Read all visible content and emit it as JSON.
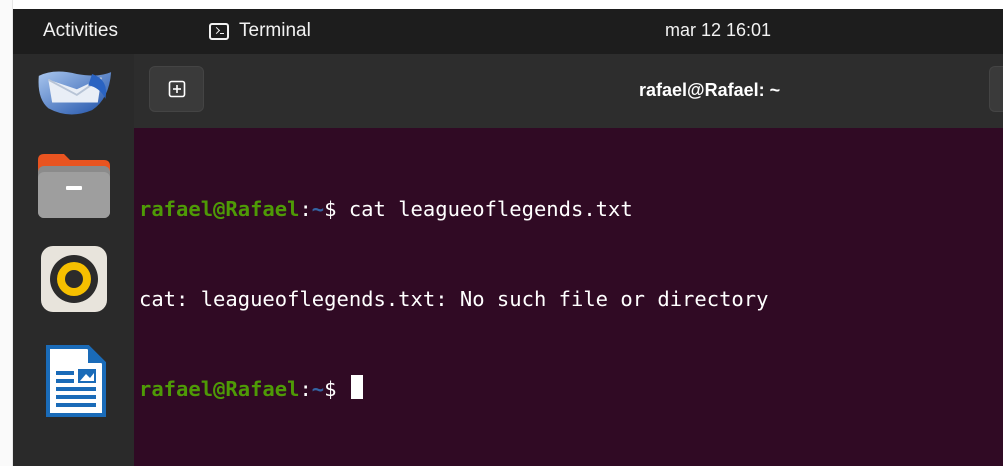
{
  "topbar": {
    "activities_label": "Activities",
    "app_name": "Terminal",
    "app_icon": "terminal-icon",
    "clock": "mar 12  16:01"
  },
  "dock": {
    "items": [
      {
        "name": "thunderbird-icon"
      },
      {
        "name": "files-icon"
      },
      {
        "name": "rhythmbox-icon"
      },
      {
        "name": "libreoffice-writer-icon"
      }
    ]
  },
  "window": {
    "title": "rafael@Rafael: ~",
    "new_tab_icon": "new-tab-icon"
  },
  "terminal": {
    "lines": [
      {
        "user": "rafael@Rafael",
        "sep": ":",
        "path": "~",
        "prompt": "$ ",
        "cmd": "cat leagueoflegends.txt"
      },
      {
        "output": "cat: leagueoflegends.txt: No such file or directory"
      },
      {
        "user": "rafael@Rafael",
        "sep": ":",
        "path": "~",
        "prompt": "$ ",
        "cmd": ""
      }
    ]
  },
  "colors": {
    "terminal_bg": "#300a24",
    "prompt_user": "#4e9a06",
    "prompt_path": "#3465a4",
    "topbar_bg": "#1d1d1d",
    "dock_bg": "#2a2a2a"
  }
}
